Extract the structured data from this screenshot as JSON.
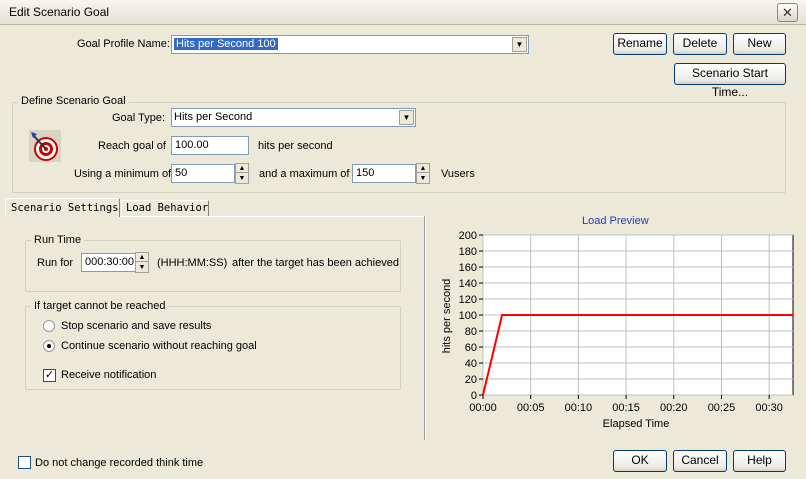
{
  "window": {
    "title": "Edit Scenario Goal",
    "close_icon": "close-icon"
  },
  "goal_profile": {
    "label": "Goal Profile Name:",
    "value": "Hits per Second 100"
  },
  "buttons": {
    "rename": "Rename",
    "delete": "Delete",
    "new": "New",
    "scenario_start": "Scenario Start Time...",
    "ok": "OK",
    "cancel": "Cancel",
    "help": "Help"
  },
  "define_goal": {
    "title": "Define Scenario Goal",
    "goal_type_label": "Goal Type:",
    "goal_type_value": "Hits per Second",
    "reach_label": "Reach goal of",
    "reach_value": "100.00",
    "reach_unit": "hits per second",
    "min_label": "Using a minimum of",
    "min_value": "50",
    "max_label": "and a maximum of",
    "max_value": "150",
    "vusers_label": "Vusers"
  },
  "tabs": [
    {
      "label": "Scenario Settings"
    },
    {
      "label": "Load Behavior"
    }
  ],
  "run_time": {
    "title": "Run Time",
    "run_for_label": "Run for",
    "value": "000:30:00",
    "format_label": "(HHH:MM:SS)",
    "after_label": "after the target has been achieved"
  },
  "unreached": {
    "title": "If target cannot be reached",
    "option_stop": "Stop scenario and save results",
    "option_continue": "Continue scenario without reaching goal",
    "notify": "Receive notification"
  },
  "footer": {
    "think_time": "Do not change recorded think time"
  },
  "chart_data": {
    "type": "line",
    "title": "Load Preview",
    "xlabel": "Elapsed Time",
    "ylabel": "hits per second",
    "ylim": [
      0,
      200
    ],
    "xlim_minutes": [
      0,
      32.5
    ],
    "yticks": [
      0,
      20,
      40,
      60,
      80,
      100,
      120,
      140,
      160,
      180,
      200
    ],
    "xticks": [
      "00:00",
      "00:05",
      "00:10",
      "00:15",
      "00:20",
      "00:25",
      "00:30"
    ],
    "grid": true,
    "series": [
      {
        "color": "#ff0000",
        "x_minutes": [
          0,
          2,
          32.5
        ],
        "y": [
          0,
          100,
          100
        ]
      }
    ]
  }
}
